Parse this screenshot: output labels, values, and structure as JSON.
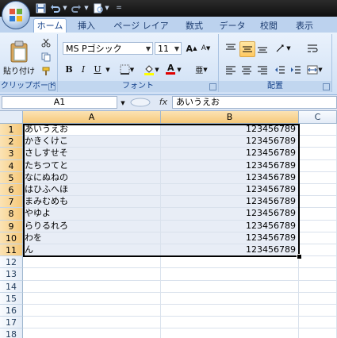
{
  "quick_access": {
    "save_icon": "save-icon",
    "undo_icon": "undo-icon",
    "redo_icon": "redo-icon",
    "customize_icon": "customize-icon"
  },
  "tabs": [
    {
      "label": "ホーム",
      "active": true
    },
    {
      "label": "挿入",
      "active": false
    },
    {
      "label": "ページ レイアウト",
      "active": false
    },
    {
      "label": "数式",
      "active": false
    },
    {
      "label": "データ",
      "active": false
    },
    {
      "label": "校閲",
      "active": false
    },
    {
      "label": "表示",
      "active": false
    }
  ],
  "ribbon": {
    "clipboard": {
      "label": "クリップボード",
      "paste_label": "貼り付け"
    },
    "font": {
      "label": "フォント",
      "font_name": "MS Pゴシック",
      "font_size": "11",
      "bold": "B",
      "italic": "I",
      "underline": "U",
      "font_color_label": "A",
      "grow": "A",
      "shrink": "A",
      "phonetic": "亜"
    },
    "alignment": {
      "label": "配置"
    }
  },
  "formula_bar": {
    "name_box": "A1",
    "fx_label": "fx",
    "content": "あいうえお"
  },
  "sheet": {
    "columns": [
      "A",
      "B",
      "C"
    ],
    "rows": [
      {
        "n": "1",
        "a": "あいうえお",
        "b": "123456789"
      },
      {
        "n": "2",
        "a": "かきくけこ",
        "b": "123456789"
      },
      {
        "n": "3",
        "a": "さしすせそ",
        "b": "123456789"
      },
      {
        "n": "4",
        "a": "たちつてと",
        "b": "123456789"
      },
      {
        "n": "5",
        "a": "なにぬねの",
        "b": "123456789"
      },
      {
        "n": "6",
        "a": "はひふへほ",
        "b": "123456789"
      },
      {
        "n": "7",
        "a": "まみむめも",
        "b": "123456789"
      },
      {
        "n": "8",
        "a": "やゆよ",
        "b": "123456789"
      },
      {
        "n": "9",
        "a": "らりるれろ",
        "b": "123456789"
      },
      {
        "n": "10",
        "a": "わを",
        "b": "123456789"
      },
      {
        "n": "11",
        "a": "ん",
        "b": "123456789"
      },
      {
        "n": "12",
        "a": "",
        "b": ""
      },
      {
        "n": "13",
        "a": "",
        "b": ""
      },
      {
        "n": "14",
        "a": "",
        "b": ""
      },
      {
        "n": "15",
        "a": "",
        "b": ""
      },
      {
        "n": "16",
        "a": "",
        "b": ""
      },
      {
        "n": "17",
        "a": "",
        "b": ""
      },
      {
        "n": "18",
        "a": "",
        "b": ""
      }
    ]
  },
  "colors": {
    "ribbon_blue": "#cfe0f5",
    "selection_header": "#f6c97a",
    "selection_fill": "#e8edf6"
  }
}
